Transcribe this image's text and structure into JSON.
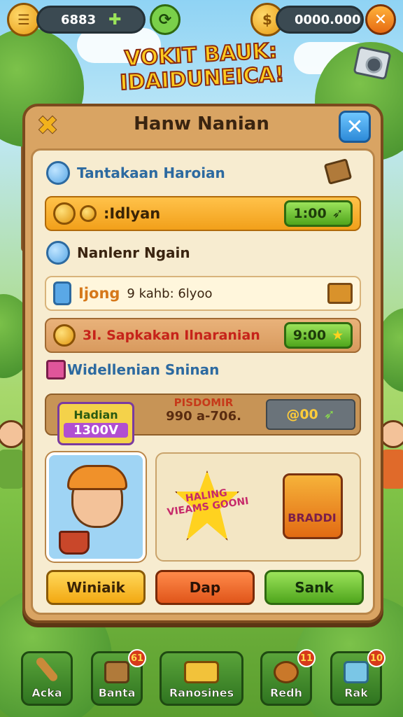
{
  "hud": {
    "gems_value": "6883",
    "coins_value": "0000.000"
  },
  "title": "VOKIT BAUK: IDAIDUNEICA!",
  "panel": {
    "title": "Hanw Nanian",
    "section1": {
      "label": "Tantakaan Haroian",
      "row_label": ":Idlyan",
      "row_button": "1:00"
    },
    "section2": {
      "label": "Nanlenr Ngain",
      "row_label_a": "Ijong",
      "row_label_b": "9 kahb: 6lyoo"
    },
    "section3": {
      "row_label": "3I. Sapkakan Ilnaranian",
      "row_button": "9:00"
    },
    "section4": {
      "label": "Widellenian Sninan",
      "badge_top": "Hadian",
      "badge_bottom": "1300V",
      "mid_top": "PISDOMIR",
      "mid_bottom": "990 a-706.",
      "button_value": "@00"
    },
    "cards": {
      "badge_text": "HALING VIEAMS GOONI",
      "gift_text": "BRADDI"
    },
    "buttons": {
      "yellow": "Winiaik",
      "orange": "Dap",
      "green": "Sank"
    }
  },
  "nav": [
    {
      "label": "Acka"
    },
    {
      "label": "Banta",
      "badge": "61"
    },
    {
      "label": "Ranosines"
    },
    {
      "label": "Redh",
      "badge": "11"
    },
    {
      "label": "Rak",
      "badge": "10"
    }
  ],
  "colors": {
    "panel_wood": "#d9a463",
    "row_orange": "#f6b53a",
    "button_green": "#4fa51c",
    "button_orange": "#e0551a",
    "button_yellow": "#f2a812"
  }
}
